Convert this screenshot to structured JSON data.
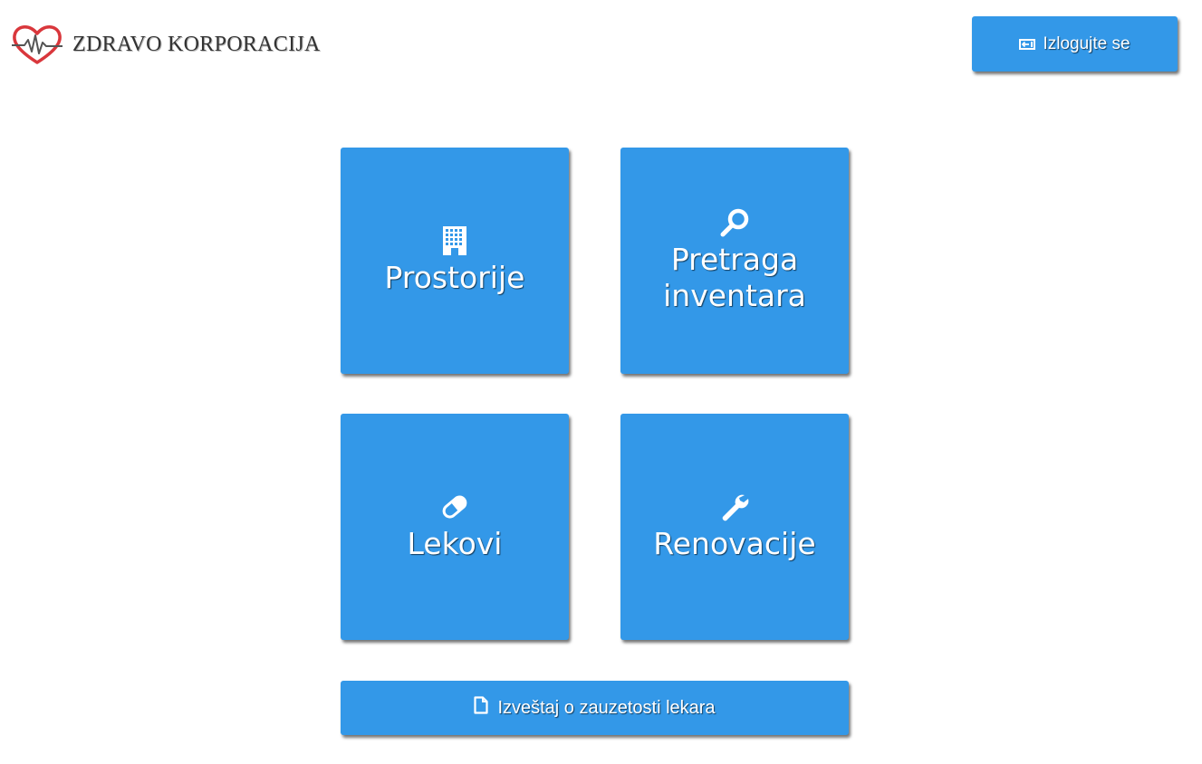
{
  "header": {
    "brand_name": "ZDRAVO KORPORACIJA",
    "logo_icon": "heart-pulse-icon",
    "logout_label": "Izlogujte se",
    "logout_icon": "logout-icon"
  },
  "tiles": [
    {
      "label": "Prostorije",
      "icon": "building-icon"
    },
    {
      "label_line1": "Pretraga",
      "label_line2": "inventara",
      "icon": "search-icon"
    },
    {
      "label": "Lekovi",
      "icon": "pill-icon"
    },
    {
      "label": "Renovacije",
      "icon": "wrench-icon"
    }
  ],
  "report": {
    "label": "Izveštaj o zauzetosti lekara",
    "icon": "document-icon"
  },
  "colors": {
    "button_bg": "#3398e8",
    "button_text": "#ffffff",
    "logo_red": "#d9373c",
    "brand_text": "#333333"
  }
}
